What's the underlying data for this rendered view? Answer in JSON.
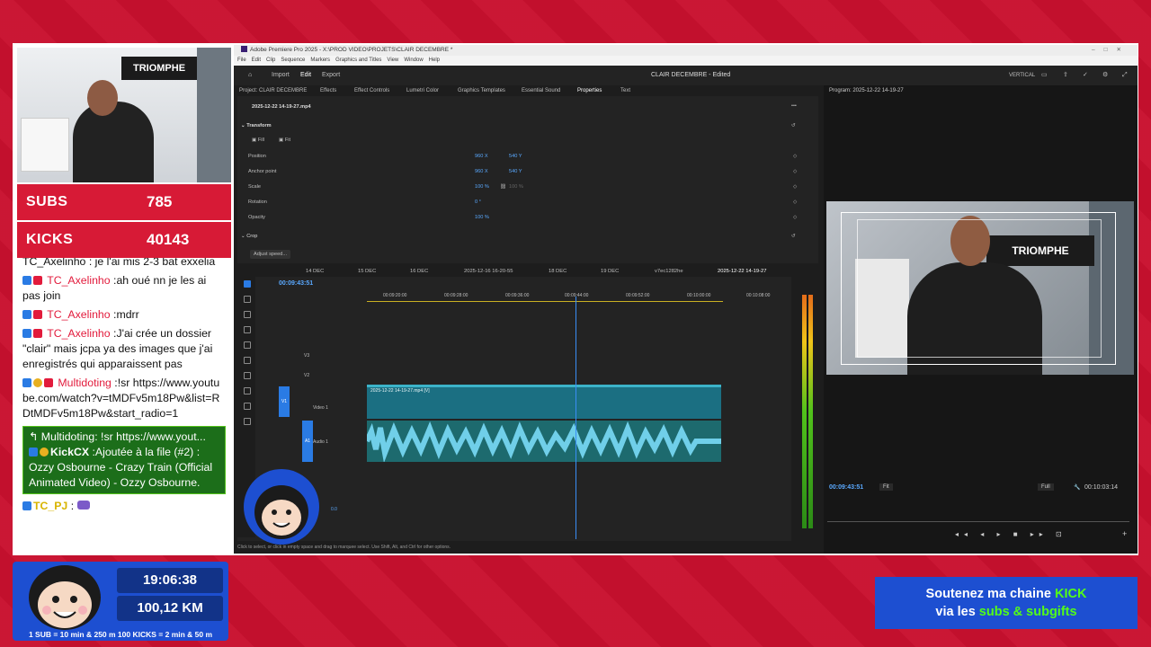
{
  "counters": {
    "subs_label": "SUBS",
    "subs_value": "785",
    "kicks_label": "KICKS",
    "kicks_value": "40143"
  },
  "webcam": {
    "banner_text": "TRIOMPHE"
  },
  "chat": {
    "top_cut": "TC_Axelinho : je l'ai mis 2-3 bat exxelia",
    "messages": [
      {
        "user": "TC_Axelinho",
        "text": "ah oué nn je les ai pas join"
      },
      {
        "user": "TC_Axelinho",
        "text": "mdrr"
      },
      {
        "user": "TC_Axelinho",
        "text": "J'ai crée un dossier \"clair\" mais jcpa ya des images que j'ai enregistrés qui apparaissent pas"
      },
      {
        "user": "Multidoting",
        "text": "!sr https://www.youtube.com/watch?v=tMDFv5m18Pw&list=RDtMDFv5m18Pw&start_radio=1"
      }
    ],
    "highlight": {
      "reply": "Multidoting: !sr https://www.yout...",
      "user": "KickCX",
      "text": "Ajoutée à la file (#2) : Ozzy Osbourne - Crazy Train (Official Animated Video) - Ozzy Osbourne."
    },
    "last_user": "TC_PJ"
  },
  "premiere": {
    "title": "Adobe Premiere Pro 2025 - X:\\PROD VIDEO\\PROJETS\\CLAIR DECEMBRE *",
    "menu": [
      "File",
      "Edit",
      "Clip",
      "Sequence",
      "Markers",
      "Graphics and Titles",
      "View",
      "Window",
      "Help"
    ],
    "header": {
      "import": "Import",
      "edit": "Edit",
      "export": "Export",
      "doc_title": "CLAIR DECEMBRE - Edited",
      "vertical": "VERTICAL"
    },
    "tabs": [
      "Project: CLAIR DECEMBRE",
      "Effects",
      "Effect Controls",
      "Lumetri Color",
      "Graphics Templates",
      "Essential Sound",
      "Properties",
      "Text"
    ],
    "clip_name": "2025-12-22 14-19-27.mp4",
    "transform": {
      "title": "Transform",
      "fill": "Fill",
      "fit": "Fit",
      "rows": [
        {
          "label": "Position",
          "v1": "960 X",
          "v2": "540 Y"
        },
        {
          "label": "Anchor point",
          "v1": "960 X",
          "v2": "540 Y"
        },
        {
          "label": "Scale",
          "v1": "100 %",
          "v2": "100 %"
        },
        {
          "label": "Rotation",
          "v1": "0 °",
          "v2": ""
        },
        {
          "label": "Opacity",
          "v1": "100 %",
          "v2": ""
        }
      ]
    },
    "crop": "Crop",
    "adjust_speed": "Adjust speed...",
    "seq_tabs": [
      "14 DEC",
      "15 DEC",
      "16 DEC",
      "2025-12-16 16-20-55",
      "18 DEC",
      "19 DEC",
      "v7ec1282he",
      "2025-12-22 14-19-27"
    ],
    "timecode": "00:09:43:51",
    "ruler": [
      "00:09:20:00",
      "00:09:28:00",
      "00:09:36:00",
      "00:09:44:00",
      "00:09:52:00",
      "00:10:00:00",
      "00:10:08:00"
    ],
    "tracks": {
      "v3": "V3",
      "v2": "V2",
      "v1": "V1",
      "video1": "Video 1",
      "a1": "A1",
      "audio1": "Audio 1",
      "vol": "0.0"
    },
    "clip_label": "2025-12-22 14-19-27.mp4 [V]",
    "program": "Program: 2025-12-22 14-19-27",
    "prog_tc_left": "00:09:43:51",
    "prog_fit": "Fit",
    "prog_full": "Full",
    "prog_tc_right": "00:10:03:14",
    "status": "Click to select, or click in empty space and drag to marquee select. Use Shift, Alt, and Ctrl for other options.",
    "video_banner": "TRIOMPHE"
  },
  "bottom": {
    "time": "19:06:38",
    "km": "100,12 KM",
    "note": "1 SUB = 10 min & 250 m   100 KICKS = 2 min & 50 m"
  },
  "promo": {
    "line1a": "Soutenez ma chaine ",
    "line1b": "KICK",
    "line2a": "via les ",
    "line2b": "subs & subgifts"
  },
  "colors": {
    "bg": "#c8102e",
    "accent_blue": "#1d4fd1",
    "kick_green": "#53fc18",
    "premiere_blue": "#2a7be4"
  }
}
